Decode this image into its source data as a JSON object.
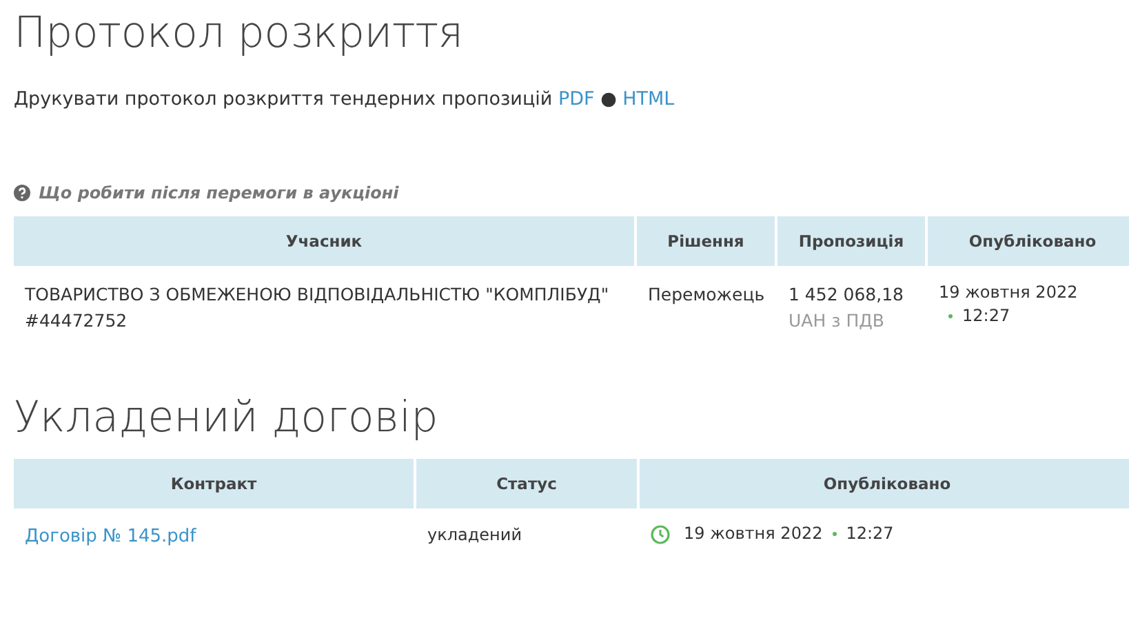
{
  "protocol": {
    "title": "Протокол розкриття",
    "print_text": "Друкувати протокол розкриття тендерних пропозицій",
    "links": [
      "PDF",
      "HTML"
    ],
    "separator": "●"
  },
  "help_link": "Що робити після перемоги в аукціоні",
  "bids_table": {
    "columns": [
      "Учасник",
      "Рішення",
      "Пропозиція",
      "Опубліковано"
    ],
    "rows": [
      {
        "participant": "ТОВАРИСТВО З ОБМЕЖЕНОЮ ВІДПОВІДАЛЬНІСТЮ \"КОМПЛІБУД\"",
        "code": "#44472752",
        "decision": "Переможець",
        "amount": "1 452 068,18",
        "currency": "UAH з ПДВ",
        "date": "19 жовтня 2022",
        "time": "12:27"
      }
    ]
  },
  "contract": {
    "title": "Укладений договір",
    "columns": [
      "Контракт",
      "Статус",
      "Опубліковано"
    ],
    "rows": [
      {
        "document": "Договір № 145.pdf",
        "status": "укладений",
        "date": "19 жовтня 2022",
        "time": "12:27"
      }
    ]
  }
}
